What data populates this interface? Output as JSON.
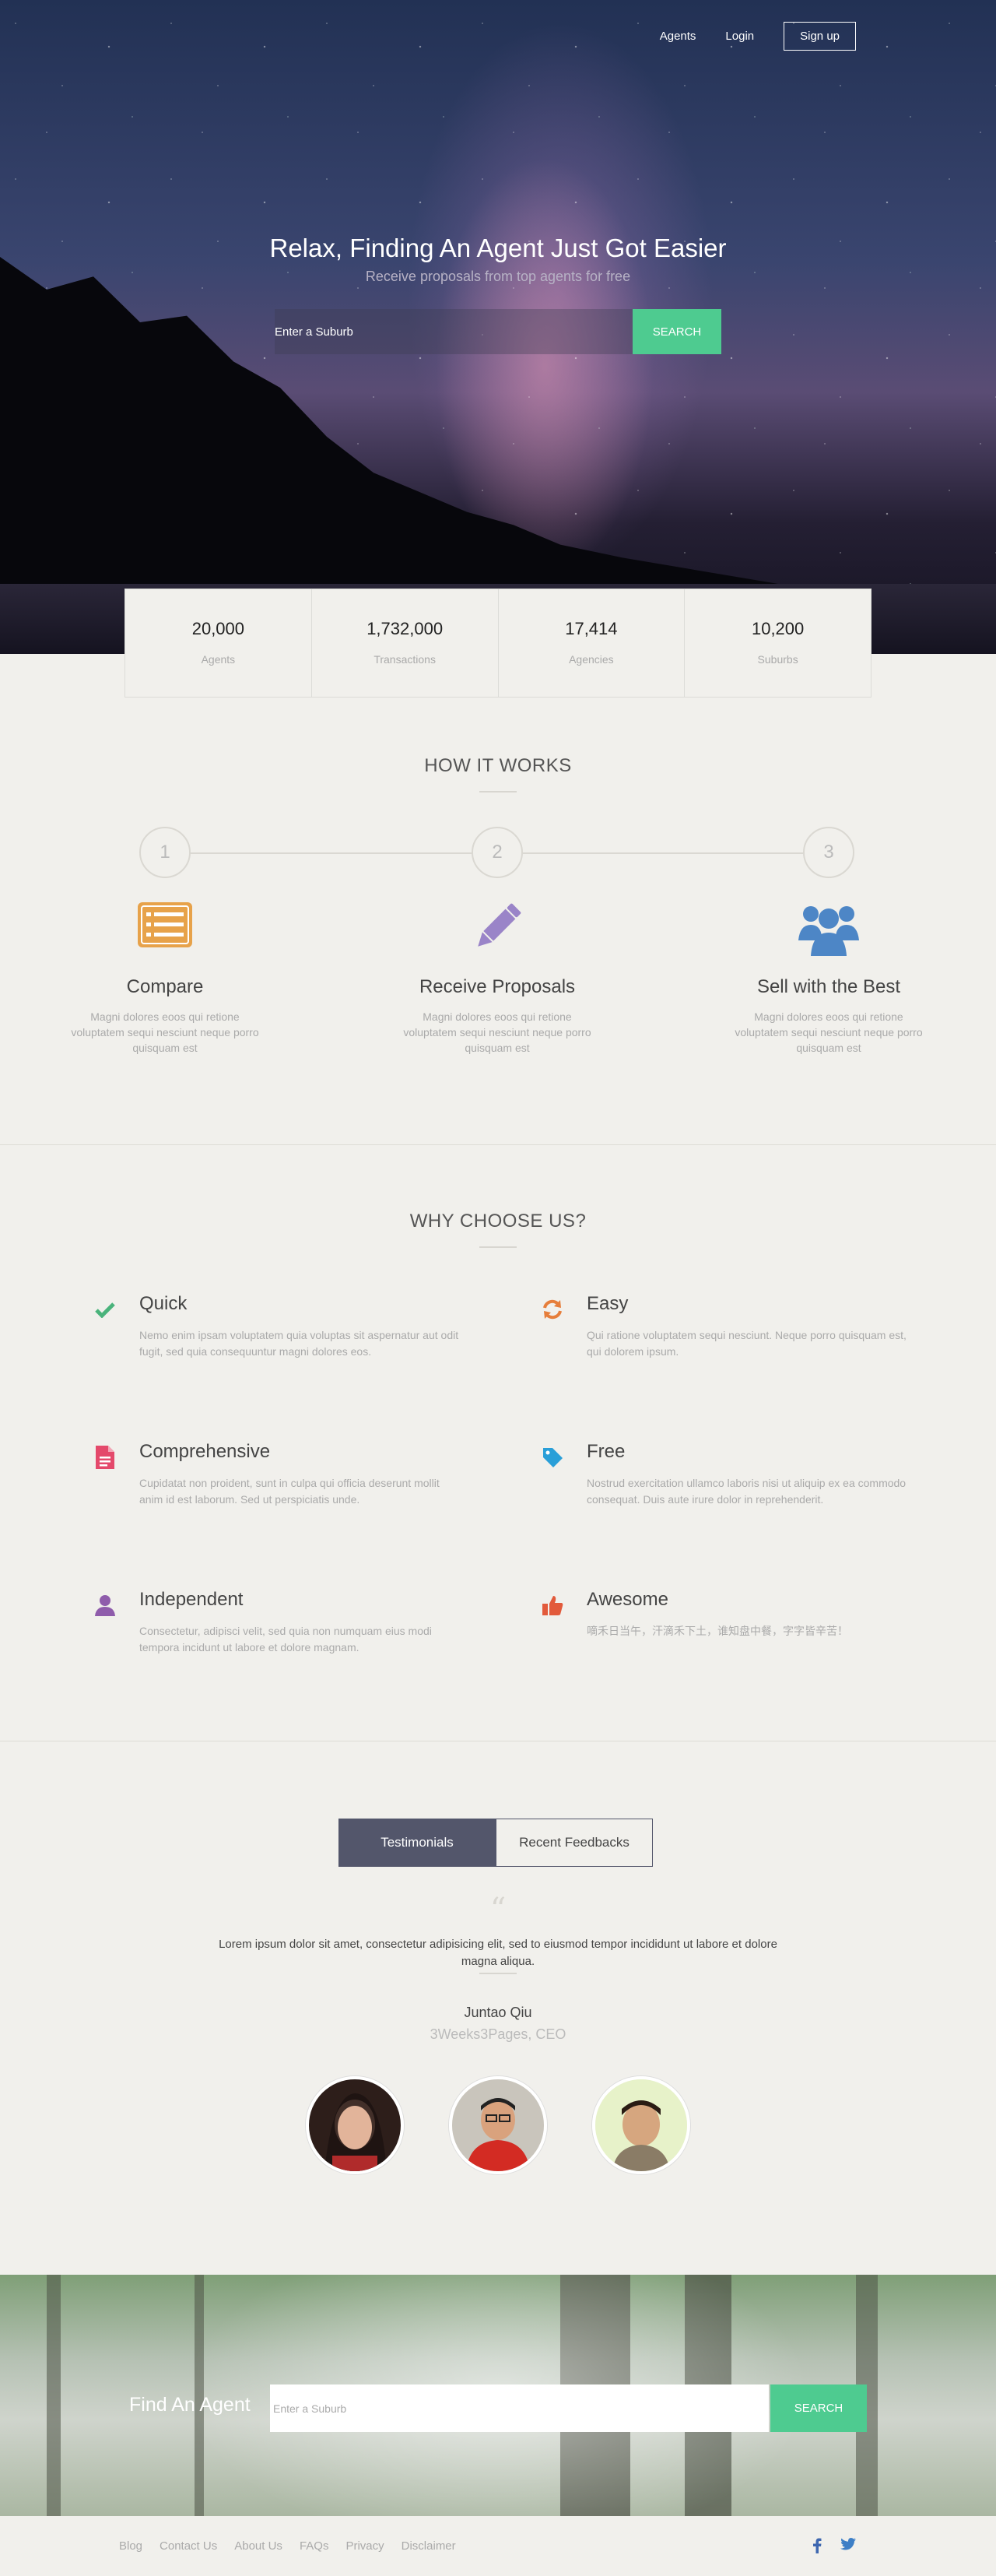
{
  "nav": {
    "agents": "Agents",
    "login": "Login",
    "signup": "Sign up"
  },
  "hero": {
    "title": "Relax, Finding An Agent Just Got Easier",
    "subtitle": "Receive proposals from top agents for free",
    "search_placeholder": "Enter a Suburb",
    "search_button": "SEARCH"
  },
  "stats": [
    {
      "value": "20,000",
      "label": "Agents"
    },
    {
      "value": "1,732,000",
      "label": "Transactions"
    },
    {
      "value": "17,414",
      "label": "Agencies"
    },
    {
      "value": "10,200",
      "label": "Suburbs"
    }
  ],
  "how": {
    "title": "HOW IT WORKS",
    "steps": [
      {
        "number": "1",
        "title": "Compare",
        "text": "Magni dolores eoos qui retione voluptatem sequi nesciunt neque porro quisquam est",
        "icon": "list-icon",
        "color": "#e7a24a"
      },
      {
        "number": "2",
        "title": "Receive Proposals",
        "text": "Magni dolores eoos qui retione voluptatem sequi nesciunt neque porro quisquam est",
        "icon": "pencil-icon",
        "color": "#9a84c8"
      },
      {
        "number": "3",
        "title": "Sell with the Best",
        "text": "Magni dolores eoos qui retione voluptatem sequi nesciunt neque porro quisquam est",
        "icon": "users-icon",
        "color": "#4d86c6"
      }
    ]
  },
  "why": {
    "title": "WHY CHOOSE US?",
    "reasons": [
      {
        "title": "Quick",
        "text": "Nemo enim ipsam voluptatem quia voluptas sit aspernatur aut odit fugit, sed quia consequuntur magni dolores eos.",
        "icon": "check-icon",
        "color": "#4ab37b"
      },
      {
        "title": "Easy",
        "text": "Qui ratione voluptatem sequi nesciunt. Neque porro quisquam est, qui dolorem ipsum.",
        "icon": "refresh-icon",
        "color": "#e67e3b"
      },
      {
        "title": "Comprehensive",
        "text": "Cupidatat non proident, sunt in culpa qui officia deserunt mollit anim id est laborum. Sed ut perspiciatis unde.",
        "icon": "document-icon",
        "color": "#e4496b"
      },
      {
        "title": "Free",
        "text": "Nostrud exercitation ullamco laboris nisi ut aliquip ex ea commodo consequat. Duis aute irure dolor in reprehenderit.",
        "icon": "tag-icon",
        "color": "#2a9fd8"
      },
      {
        "title": "Independent",
        "text": "Consectetur, adipisci velit, sed quia non numquam eius modi tempora incidunt ut labore et dolore magnam.",
        "icon": "user-icon",
        "color": "#8f5cab"
      },
      {
        "title": "Awesome",
        "text": "嘀禾日当午，汗滴禾下土，谁知盘中餐，字字皆辛苦！",
        "icon": "thumbs-up-icon",
        "color": "#e25a3b"
      }
    ]
  },
  "testimonials": {
    "tab_active": "Testimonials",
    "tab_other": "Recent Feedbacks",
    "quote_mark": "“",
    "quote": "Lorem ipsum dolor sit amet, consectetur adipisicing elit, sed to eiusmod tempor incididunt ut labore et dolore magna aliqua.",
    "name": "Juntao Qiu",
    "role": "3Weeks3Pages, CEO"
  },
  "cta": {
    "title": "Find An Agent",
    "search_placeholder": "Enter a Suburb",
    "search_button": "SEARCH"
  },
  "footer": {
    "links": [
      "Blog",
      "Contact Us",
      "About Us",
      "FAQs",
      "Privacy",
      "Disclaimer"
    ],
    "social": [
      "facebook-icon",
      "twitter-icon"
    ]
  }
}
